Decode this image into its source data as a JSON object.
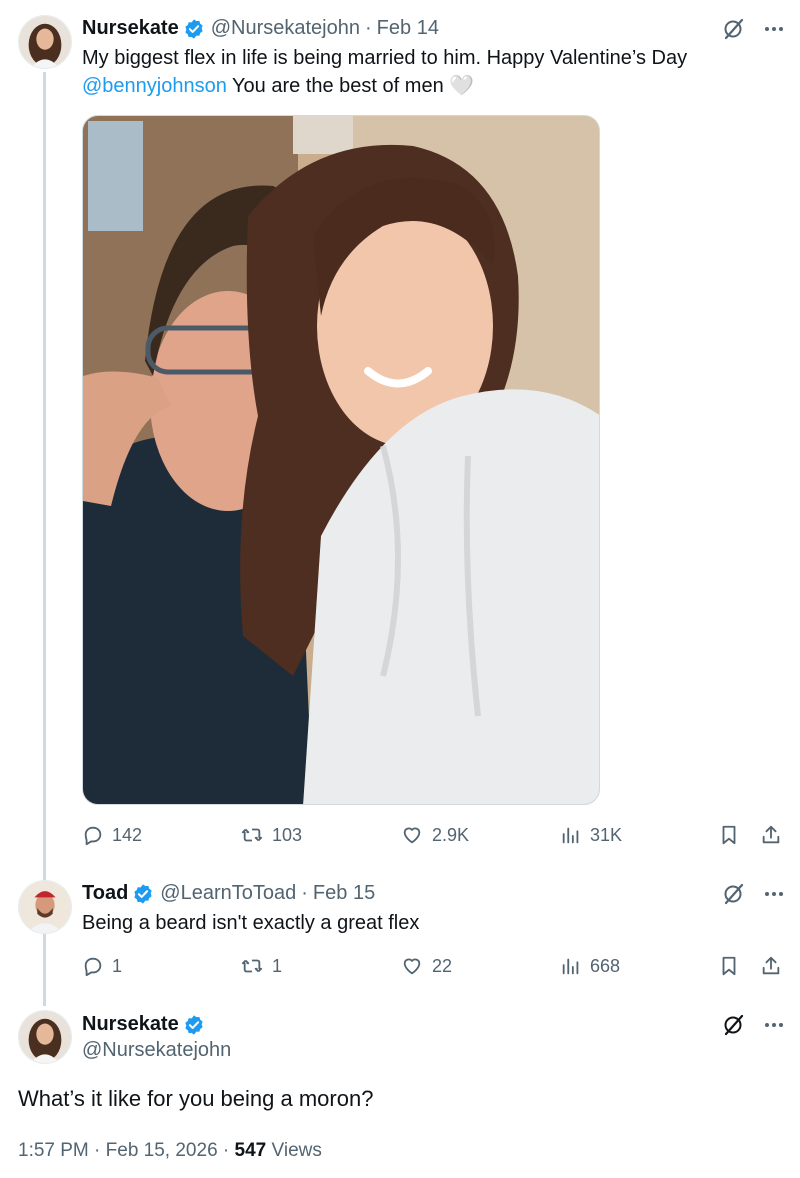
{
  "tweets": [
    {
      "name": "Nursekate",
      "handle": "@Nursekatejohn",
      "separator": "·",
      "date": "Feb 14",
      "text_part1": "My biggest flex in life is being married to him. Happy Valentine’s Day",
      "mention": "@bennyjohnson",
      "text_part2": " You are the best of men",
      "heart_emoji": "🤍",
      "stats": {
        "replies": "142",
        "reposts": "103",
        "likes": "2.9K",
        "views": "31K"
      }
    },
    {
      "name": "Toad",
      "handle": "@LearnToToad",
      "separator": "·",
      "date": "Feb 15",
      "text": "Being a beard isn't exactly a great flex",
      "stats": {
        "replies": "1",
        "reposts": "1",
        "likes": "22",
        "views": "668"
      }
    },
    {
      "name": "Nursekate",
      "handle": "@Nursekatejohn",
      "text": "What’s it like for you being a moron?",
      "time": "1:57 PM",
      "separator": "·",
      "full_date": "Feb 15, 2026",
      "views_count": "547",
      "views_label": "Views"
    }
  ],
  "colors": {
    "accent": "#1d9bf0",
    "text_primary": "#0f1419",
    "text_secondary": "#536471",
    "thread_line": "#cfd9de"
  },
  "icons": [
    "verified-badge-icon",
    "grok-icon",
    "more-icon",
    "reply-icon",
    "repost-icon",
    "like-icon",
    "views-icon",
    "bookmark-icon",
    "share-icon"
  ]
}
